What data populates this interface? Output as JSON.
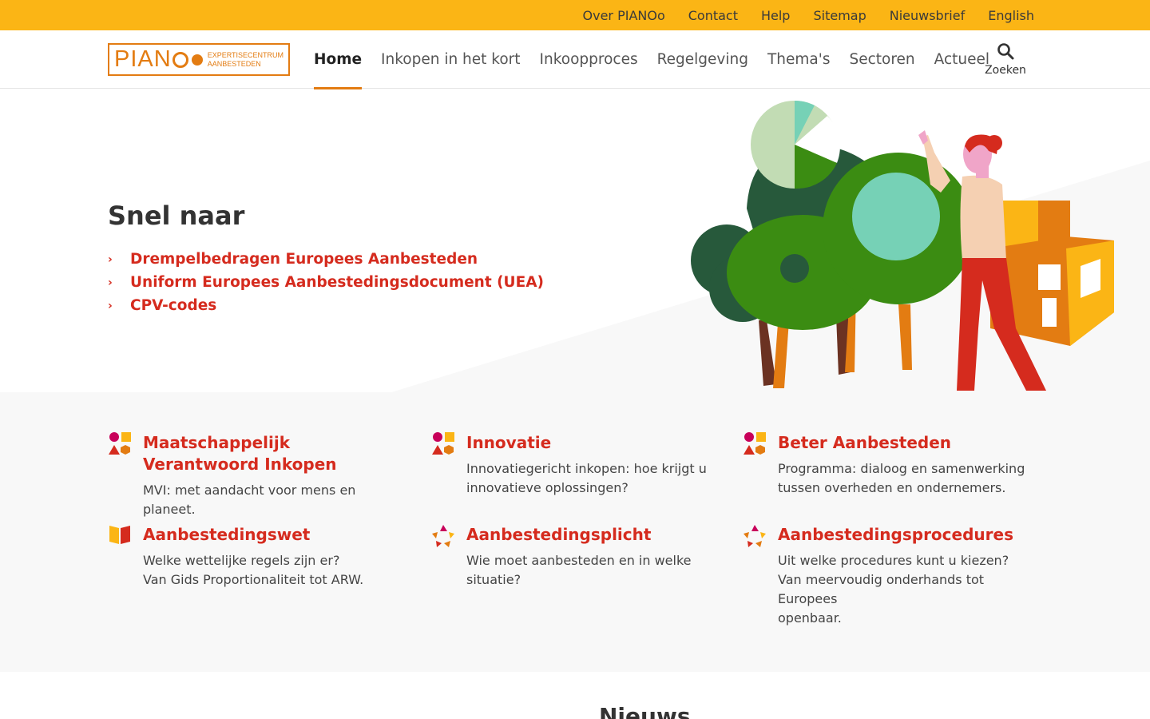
{
  "topbar": {
    "links": [
      "Over PIANOo",
      "Contact",
      "Help",
      "Sitemap",
      "Nieuwsbrief",
      "English"
    ]
  },
  "logo": {
    "word": "PIAN",
    "sub_line1": "EXPERTISECENTRUM",
    "sub_line2": "AANBESTEDEN"
  },
  "nav": {
    "items": [
      "Home",
      "Inkopen in het kort",
      "Inkoopproces",
      "Regelgeving",
      "Thema's",
      "Sectoren",
      "Actueel"
    ],
    "active": "Home",
    "search_label": "Zoeken"
  },
  "hero": {
    "title": "Snel naar",
    "links": [
      "Drempelbedragen Europees Aanbesteden",
      "Uniform Europees Aanbestedingsdocument (UEA)",
      "CPV-codes"
    ]
  },
  "themes": [
    {
      "title": "Maatschappelijk Verantwoord Inkopen",
      "desc": [
        "MVI: met aandacht voor mens en planeet."
      ],
      "icon": "shapes-icon"
    },
    {
      "title": "Innovatie",
      "desc": [
        "Innovatiegericht inkopen: hoe krijgt u",
        "innovatieve oplossingen?"
      ],
      "icon": "shapes-icon"
    },
    {
      "title": "Beter Aanbesteden",
      "desc": [
        "Programma: dialoog en samenwerking",
        "tussen overheden en ondernemers."
      ],
      "icon": "shapes-icon"
    },
    {
      "title": "Aanbestedingswet",
      "desc": [
        "Welke wettelijke regels zijn er?",
        "Van Gids Proportionaliteit tot ARW."
      ],
      "icon": "book-icon"
    },
    {
      "title": "Aanbestedingsplicht",
      "desc": [
        "Wie moet aanbesteden en in welke",
        "situatie?"
      ],
      "icon": "star-icon"
    },
    {
      "title": "Aanbestedingsprocedures",
      "desc": [
        "Uit welke procedures kunt u kiezen?",
        "Van meervoudig onderhands tot Europees",
        "openbaar."
      ],
      "icon": "star-icon"
    }
  ],
  "news": {
    "heading": "Nieuws"
  },
  "colors": {
    "topbar": "#fbb515",
    "accent": "#e37c12",
    "link_red": "#d52b1e",
    "themes_bg": "#f8f8f8"
  }
}
